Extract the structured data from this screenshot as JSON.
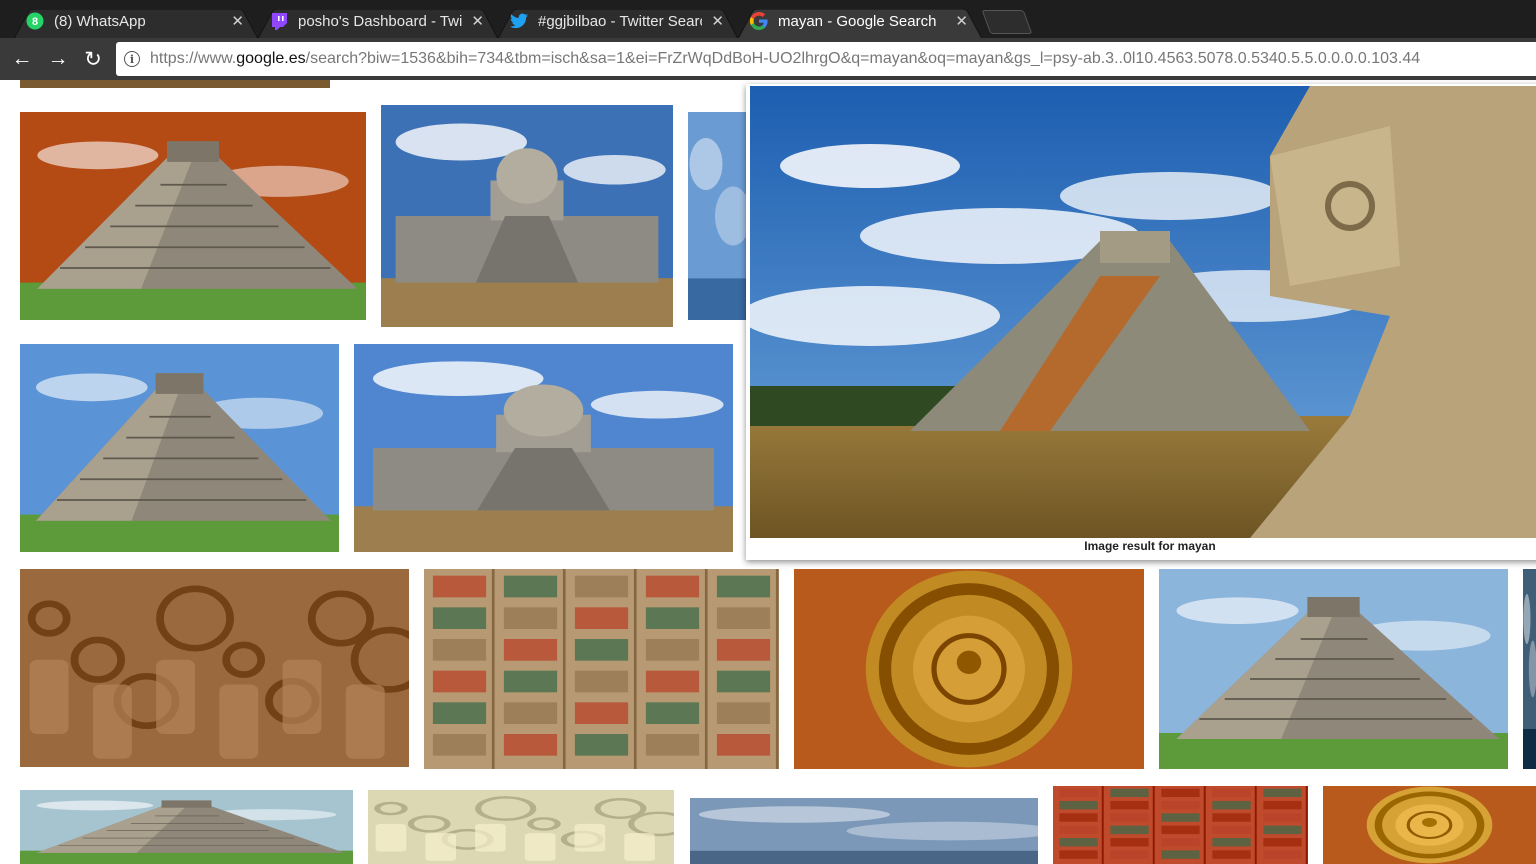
{
  "tabs": [
    {
      "title": "(8) WhatsApp",
      "favicon": "whatsapp-icon",
      "badge": "8",
      "active": false
    },
    {
      "title": "posho's Dashboard - Twitch",
      "favicon": "twitch-icon",
      "active": false
    },
    {
      "title": "#ggjbilbao - Twitter Search",
      "favicon": "twitter-icon",
      "active": false
    },
    {
      "title": "mayan - Google Search",
      "favicon": "google-icon",
      "active": true
    }
  ],
  "close_glyph": "✕",
  "toolbar": {
    "back_glyph": "←",
    "forward_glyph": "→",
    "reload_glyph": "↻",
    "info_glyph": "i",
    "url_prefix": "https://www.",
    "url_domain": "google.es",
    "url_rest": "/search?biw=1536&bih=734&tbm=isch&sa=1&ei=FrZrWqDdBoH-UO2lhrgO&q=mayan&oq=mayan&gs_l=psy-ab.3..0l10.4563.5078.0.5340.5.5.0.0.0.0.103.44"
  },
  "results": [
    {
      "id": "pyramid-sunset",
      "kind": "pyramid",
      "sky": "#b44a14"
    },
    {
      "id": "observatory",
      "kind": "observatory",
      "sky": "#3d71b6"
    },
    {
      "id": "partial-cut",
      "kind": "partial",
      "sky": "#6a9bd2"
    },
    {
      "id": "pyramid-closeup",
      "kind": "pyramid",
      "sky": "#5b94d6"
    },
    {
      "id": "observatory-wide",
      "kind": "observatory",
      "sky": "#4f86cf"
    },
    {
      "id": "stone-carving",
      "kind": "carving",
      "sky": "#9a6a3e"
    },
    {
      "id": "codex",
      "kind": "codex",
      "sky": "#b79a73"
    },
    {
      "id": "calendar",
      "kind": "calendar",
      "sky": "#c18a22"
    },
    {
      "id": "pyramid-bright",
      "kind": "pyramid",
      "sky": "#8cb5dc"
    },
    {
      "id": "right-edge",
      "kind": "partial",
      "sky": "#3f5e78"
    },
    {
      "id": "temple-jungle",
      "kind": "pyramid",
      "sky": "#a6c4d0"
    },
    {
      "id": "figure",
      "kind": "carving",
      "sky": "#ddd8b4"
    },
    {
      "id": "clouds",
      "kind": "partial",
      "sky": "#7c98b8"
    },
    {
      "id": "red-codex",
      "kind": "codex",
      "sky": "#c04a2c"
    },
    {
      "id": "gold-calendar",
      "kind": "calendar",
      "sky": "#d6a236"
    }
  ],
  "preview": {
    "caption": "Image result for mayan"
  }
}
